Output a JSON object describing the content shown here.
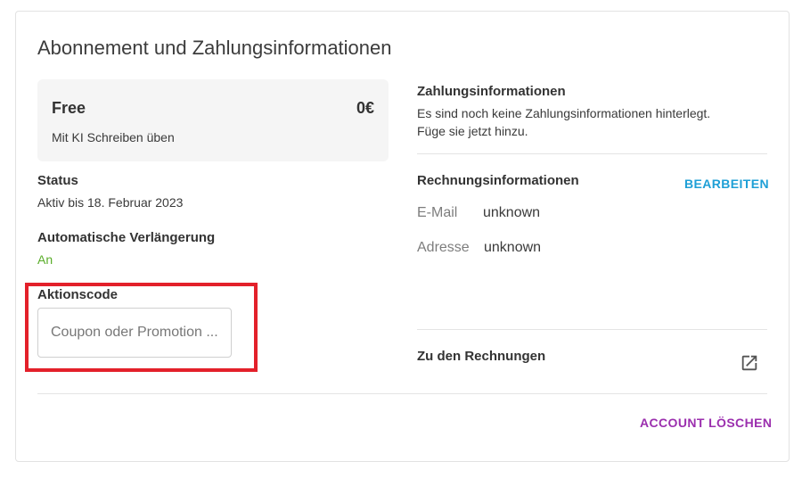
{
  "page": {
    "title": "Abonnement und Zahlungsinformationen"
  },
  "plan": {
    "name": "Free",
    "price": "0€",
    "description": "Mit KI Schreiben üben"
  },
  "status": {
    "label": "Status",
    "value": "Aktiv bis 18. Februar 2023"
  },
  "renewal": {
    "label": "Automatische Verlängerung",
    "value": "An"
  },
  "promo": {
    "label": "Aktionscode",
    "placeholder": "Coupon oder Promotion ..."
  },
  "payment": {
    "heading": "Zahlungsinformationen",
    "line1": "Es sind noch keine Zahlungsinformationen hinterlegt.",
    "line2": "Füge sie jetzt hinzu."
  },
  "billing": {
    "heading": "Rechnungsinformationen",
    "edit_label": "BEARBEITEN",
    "email_key": "E-Mail",
    "email_value": "unknown",
    "address_key": "Adresse",
    "address_value": "unknown"
  },
  "invoices": {
    "label": "Zu den Rechnungen"
  },
  "account": {
    "delete_label": "ACCOUNT LÖSCHEN"
  },
  "colors": {
    "edit_link": "#1e9fd6",
    "delete_link": "#9b2fae",
    "active_green": "#5aad2a",
    "highlight_red": "#e3202a"
  },
  "icons": {
    "invoices": "open-in-new-icon"
  }
}
